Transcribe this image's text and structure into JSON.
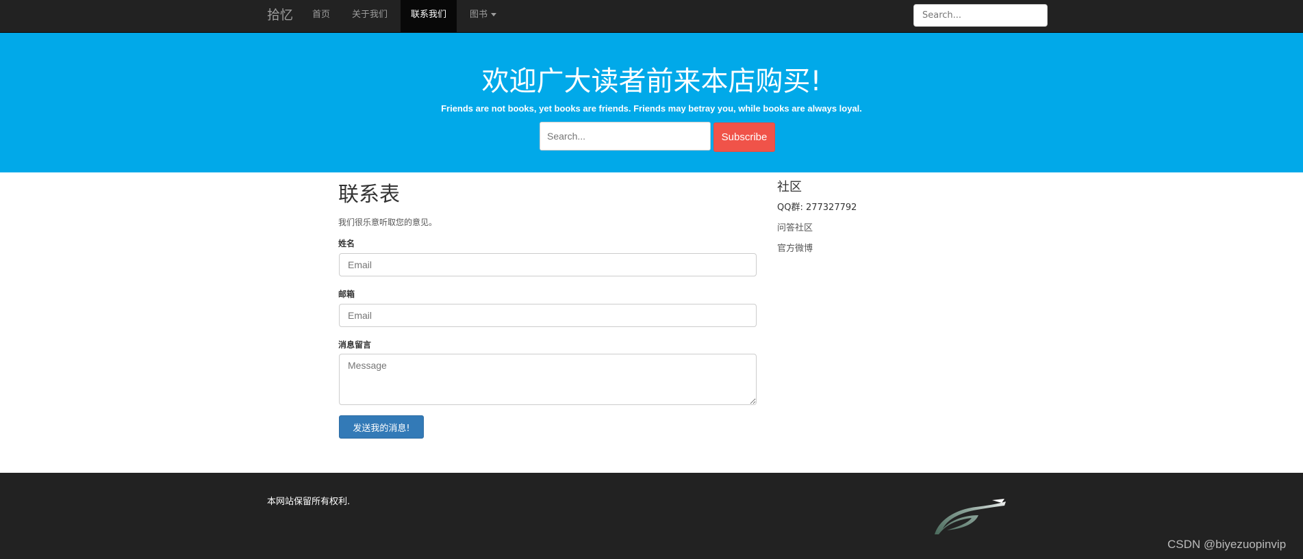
{
  "navbar": {
    "brand": "拾忆",
    "items": [
      {
        "label": "首页",
        "active": false
      },
      {
        "label": "关于我们",
        "active": false
      },
      {
        "label": "联系我们",
        "active": true
      },
      {
        "label": "图书",
        "active": false,
        "dropdown": true
      }
    ],
    "search_placeholder": "Search..."
  },
  "hero": {
    "title": "欢迎广大读者前来本店购买!",
    "subtitle": "Friends are not books, yet books are friends. Friends may betray you, while books are always loyal.",
    "search_placeholder": "Search...",
    "subscribe_label": "Subscribe",
    "background_color": "#01a9e9",
    "button_color": "#f05349"
  },
  "contact_form": {
    "title": "联系表",
    "description": "我们很乐意听取您的意见。",
    "name_label": "姓名",
    "name_placeholder": "Email",
    "email_label": "邮箱",
    "email_placeholder": "Email",
    "message_label": "消息留言",
    "message_placeholder": "Message",
    "submit_label": "发送我的消息!",
    "submit_color": "#337ab7"
  },
  "sidebar": {
    "title": "社区",
    "qq_label": "QQ群: 277327792",
    "links": [
      "问答社区",
      "官方微博"
    ]
  },
  "footer": {
    "copyright": "本网站保留所有权利.",
    "logo_icon": "swoosh-logo-icon"
  },
  "watermark": "CSDN @biyezuopinvip"
}
